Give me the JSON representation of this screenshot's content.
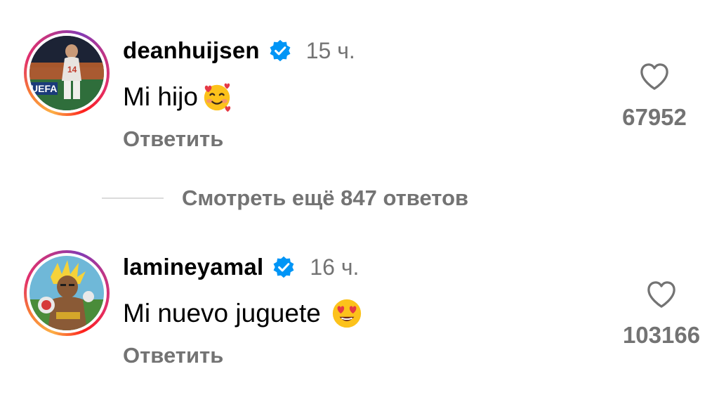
{
  "comments": [
    {
      "username": "deanhuijsen",
      "verified": true,
      "time": "15 ч.",
      "text": "Mi hijo",
      "emoji": "smiling-face-with-hearts",
      "reply_label": "Ответить",
      "likes": "67952",
      "avatar_badge": "14"
    },
    {
      "username": "lamineyamal",
      "verified": true,
      "time": "16 ч.",
      "text": "Mi nuevo juguete",
      "emoji": "heart-eyes",
      "reply_label": "Ответить",
      "likes": "103166"
    }
  ],
  "view_replies_label": "Смотреть ещё 847 ответов",
  "colors": {
    "verified_blue": "#0095f6",
    "secondary_text": "#737373",
    "divider": "#dbdbdb"
  },
  "icons": [
    "verified-badge-icon",
    "heart-outline-icon"
  ]
}
